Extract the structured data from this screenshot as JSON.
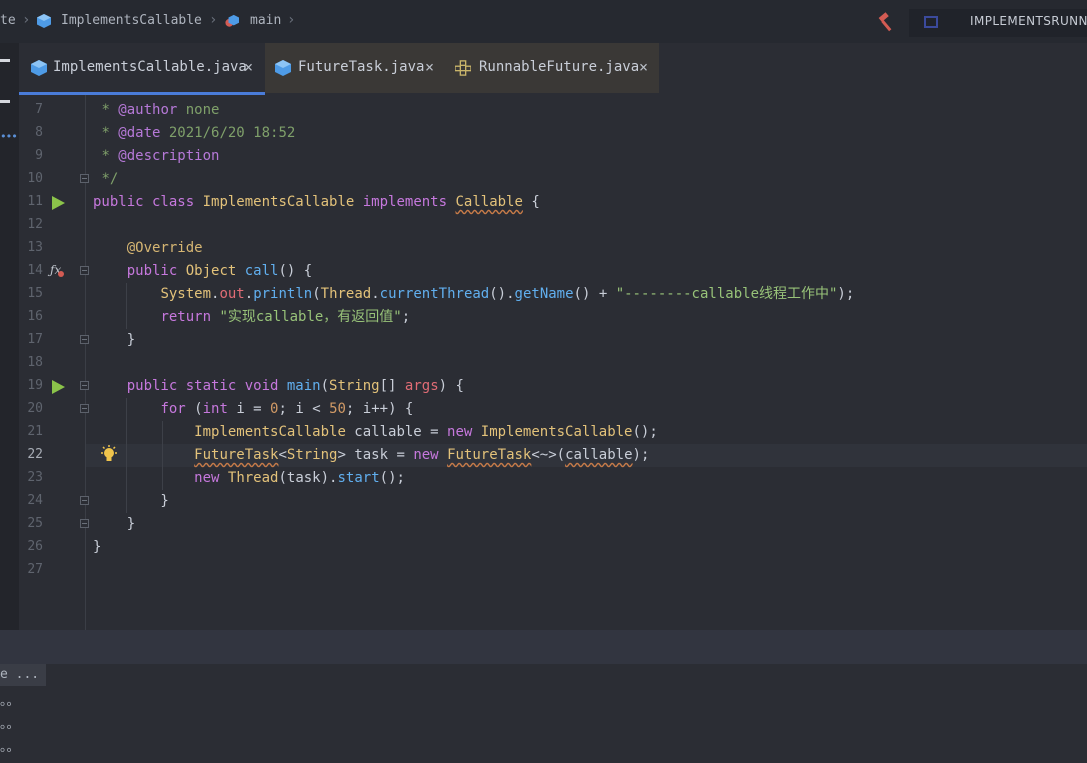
{
  "nav": {
    "crumbs": [
      "te",
      "ImplementsCallable",
      "main"
    ],
    "run_config": "IMPLEMENTSRUNNA"
  },
  "tabs": [
    {
      "label": "ImplementsCallable.java",
      "active": true,
      "icon": "java-class-icon"
    },
    {
      "label": "FutureTask.java",
      "active": false,
      "icon": "java-class-icon"
    },
    {
      "label": "RunnableFuture.java",
      "active": false,
      "icon": "interface-icon"
    }
  ],
  "colors": {
    "accent": "#4a7cd9",
    "keyword": "#c678dd",
    "class": "#e3c27a",
    "string": "#98c379",
    "run_arrow": "#8bc34a"
  },
  "editor": {
    "current_line": 22,
    "lines": [
      {
        "n": 7,
        "html": " <span class=\"cm\">* <span class=\"tag\">@author</span> none</span>"
      },
      {
        "n": 8,
        "html": " <span class=\"cm\">* <span class=\"tag\">@date</span> 2021/6/20 18:52</span>"
      },
      {
        "n": 9,
        "html": " <span class=\"cm\">* <span class=\"tag\">@description</span></span>"
      },
      {
        "n": 10,
        "html": " <span class=\"cm\">*/</span>"
      },
      {
        "n": 11,
        "html": "<span class=\"kw\">public class</span> <span class=\"cls\">ImplementsCallable</span> <span class=\"kw\">implements</span> <span class=\"cls wavy\">Callable</span> {"
      },
      {
        "n": 12,
        "html": ""
      },
      {
        "n": 13,
        "html": "    <span class=\"ann\">@Override</span>"
      },
      {
        "n": 14,
        "html": "    <span class=\"kw\">public</span> <span class=\"cls\">Object</span> <span class=\"fn\">call</span>() {"
      },
      {
        "n": 15,
        "html": "        <span class=\"cls\">System</span>.<span class=\"par\">out</span>.<span class=\"fn\">println</span>(<span class=\"cls\">Thread</span>.<span class=\"fn\">currentThread</span>().<span class=\"fn\">getName</span>() + <span class=\"str\">\"--------callable线程工作中\"</span>);"
      },
      {
        "n": 16,
        "html": "        <span class=\"kw\">return</span> <span class=\"str\">\"实现callable，有返回值\"</span>;"
      },
      {
        "n": 17,
        "html": "    }"
      },
      {
        "n": 18,
        "html": ""
      },
      {
        "n": 19,
        "html": "    <span class=\"kw\">public static void</span> <span class=\"fn\">main</span>(<span class=\"cls\">String</span>[] <span class=\"par\">args</span>) {"
      },
      {
        "n": 20,
        "html": "        <span class=\"kw\">for</span> (<span class=\"kw\">int</span> i = <span class=\"num\">0</span>; i &lt; <span class=\"num\">50</span>; i++) {"
      },
      {
        "n": 21,
        "html": "            <span class=\"cls\">ImplementsCallable</span> callable = <span class=\"kw\">new</span> <span class=\"cls\">ImplementsCallable</span>();"
      },
      {
        "n": 22,
        "html": "            <span class=\"cls wavy\">FutureTask</span>&lt;<span class=\"cls\">String</span>&gt; task = <span class=\"kw\">new</span> <span class=\"cls wavy\">FutureTask</span>&lt;~&gt;(<span class=\"wavy\">callable</span>);"
      },
      {
        "n": 23,
        "html": "            <span class=\"kw\">new</span> <span class=\"cls\">Thread</span>(task).<span class=\"fn\">start</span>();"
      },
      {
        "n": 24,
        "html": "        }"
      },
      {
        "n": 25,
        "html": "    }"
      },
      {
        "n": 26,
        "html": "}"
      },
      {
        "n": 27,
        "html": ""
      }
    ]
  },
  "console": {
    "lines": [
      "e ...",
      "。。",
      "。。",
      "。。"
    ]
  }
}
